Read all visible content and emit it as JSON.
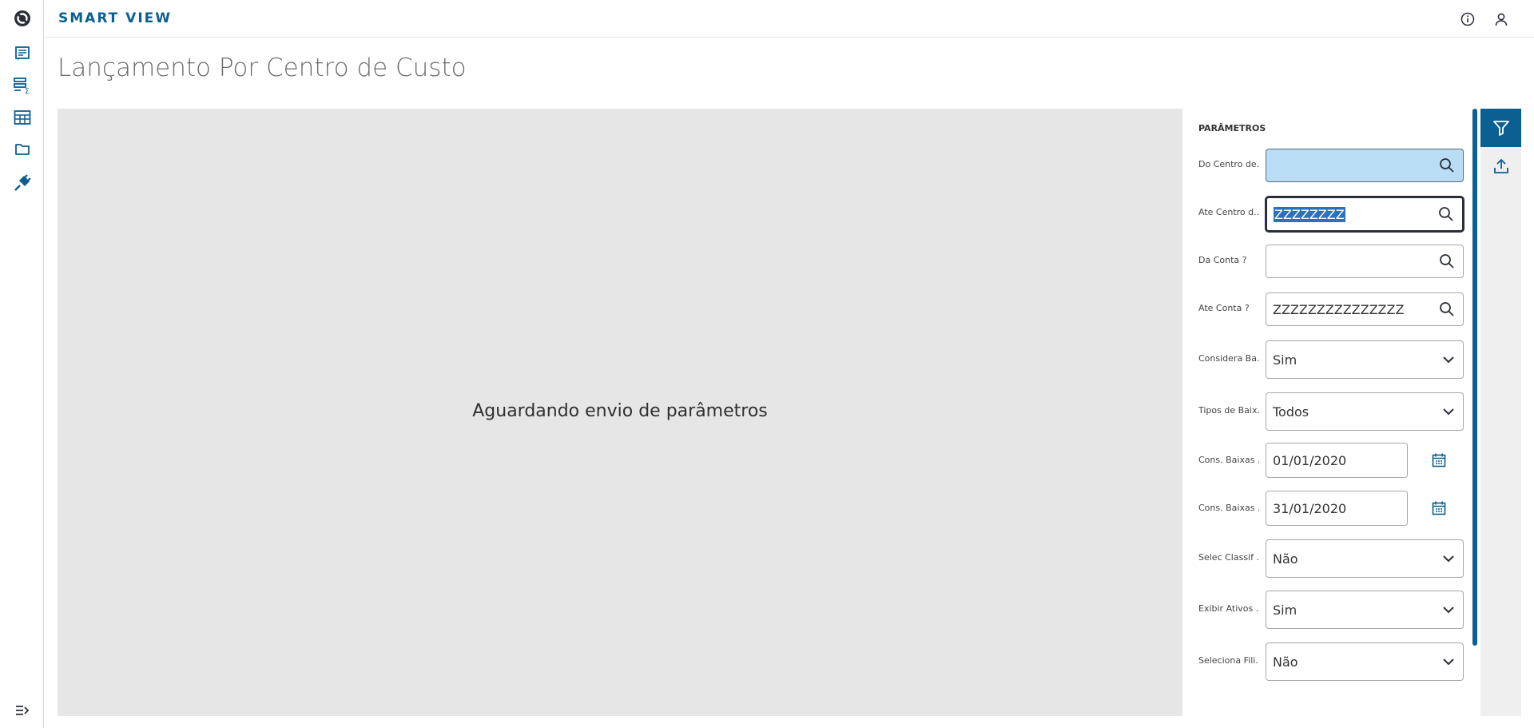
{
  "app": {
    "title": "SMART VIEW"
  },
  "page": {
    "title": "Lançamento Por Centro de Custo"
  },
  "preview": {
    "message": "Aguardando envio de parâmetros"
  },
  "params": {
    "heading": "PARÂMETROS",
    "fields": [
      {
        "label": "Do Centro de...",
        "value": "",
        "kind": "lookup"
      },
      {
        "label": "Ate Centro d...",
        "value": "ZZZZZZZZ",
        "kind": "lookup"
      },
      {
        "label": "Da Conta ?",
        "value": "",
        "kind": "lookup"
      },
      {
        "label": "Ate Conta ?",
        "value": "ZZZZZZZZZZZZZZZ",
        "kind": "lookup"
      },
      {
        "label": "Considera Ba...",
        "value": "Sim",
        "kind": "select"
      },
      {
        "label": "Tipos de Baix...",
        "value": "Todos",
        "kind": "select"
      },
      {
        "label": "Cons. Baixas ...",
        "value": "01/01/2020",
        "kind": "date"
      },
      {
        "label": "Cons. Baixas ...",
        "value": "31/01/2020",
        "kind": "date"
      },
      {
        "label": "Selec Classif ...",
        "value": "Não",
        "kind": "select"
      },
      {
        "label": "Exibir Ativos ...",
        "value": "Sim",
        "kind": "select"
      },
      {
        "label": "Seleciona Fili...",
        "value": "Não",
        "kind": "select"
      }
    ]
  },
  "icons": {
    "sidebar": [
      "app-logo-icon",
      "report-icon",
      "data-view-icon",
      "table-icon",
      "folder-icon",
      "plug-icon",
      "expand-menu-icon"
    ],
    "topbar": [
      "info-icon",
      "user-icon"
    ],
    "rail": [
      "filter-icon",
      "export-icon"
    ],
    "field": [
      "search-icon",
      "chevron-down-icon",
      "calendar-icon"
    ]
  },
  "colors": {
    "brand": "#0c5f91",
    "preview_bg": "#e6e6e6",
    "highlight_field": "#b8ddf5"
  }
}
